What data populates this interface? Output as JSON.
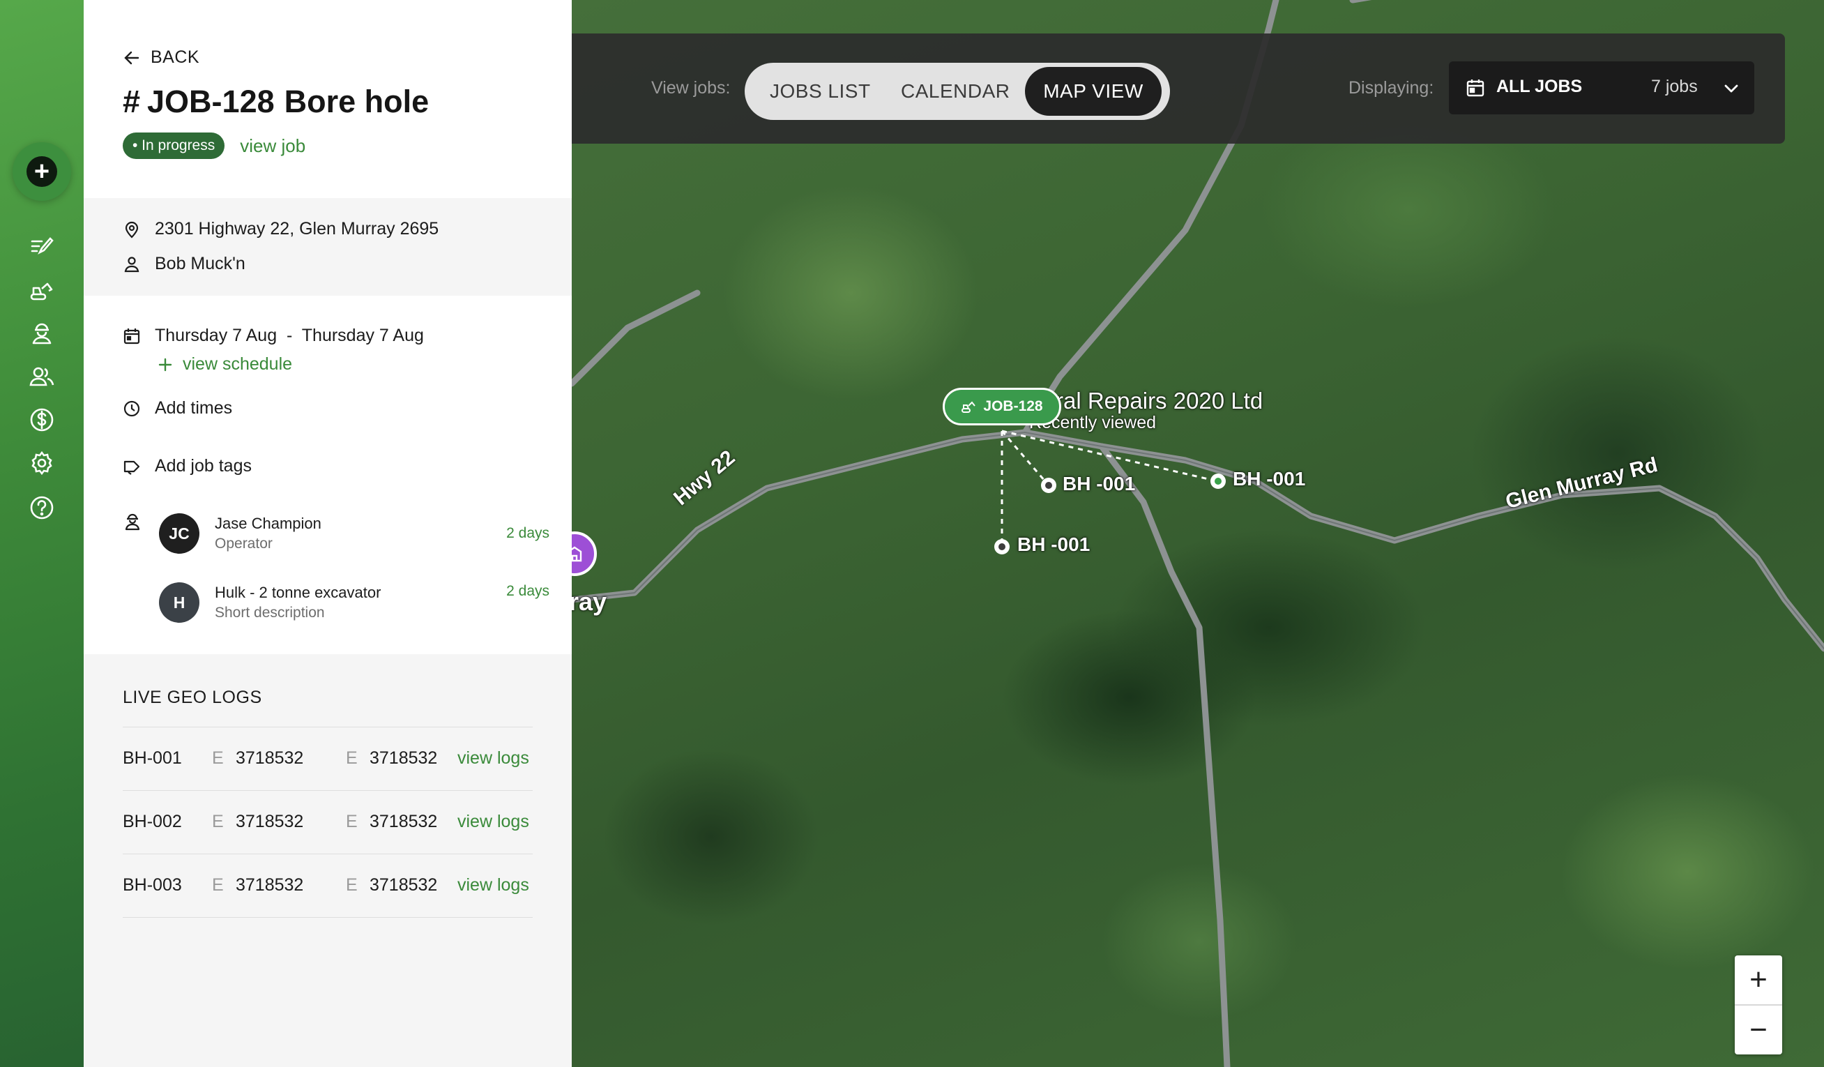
{
  "nav": {
    "add_icon": "plus-circle-icon",
    "items": [
      {
        "icon": "jobs-icon"
      },
      {
        "icon": "machinery-icon"
      },
      {
        "icon": "operator-icon"
      },
      {
        "icon": "users-icon"
      },
      {
        "icon": "dollar-icon"
      },
      {
        "icon": "gear-icon"
      },
      {
        "icon": "help-icon"
      }
    ]
  },
  "panel": {
    "back_label": "BACK",
    "job_hash": "#",
    "job_code": "JOB-128",
    "job_name": "Bore hole",
    "status": "• In progress",
    "view_job": "view job",
    "address": "2301 Highway 22, Glen Murray 2695",
    "customer": "Bob Muck'n",
    "date_range": "Thursday 7 Aug  -  Thursday 7 Aug",
    "view_schedule": "view schedule",
    "add_times": "Add times",
    "add_job_tags": "Add job tags",
    "resources": [
      {
        "initials": "JC",
        "name": "Jase Champion",
        "sub": "Operator",
        "days": "2 days",
        "color": "#1f1f1f"
      },
      {
        "initials": "H",
        "name": "Hulk - 2 tonne excavator",
        "sub": "Short description",
        "days": "2 days",
        "color": "#3b4147"
      }
    ],
    "geo_title": "LIVE GEO LOGS",
    "geo_logs": [
      {
        "id": "BH-001",
        "e1_label": "E",
        "e1": "3718532",
        "e2_label": "E",
        "e2": "3718532",
        "link": "view logs"
      },
      {
        "id": "BH-002",
        "e1_label": "E",
        "e1": "3718532",
        "e2_label": "E",
        "e2": "3718532",
        "link": "view logs"
      },
      {
        "id": "BH-003",
        "e1_label": "E",
        "e1": "3718532",
        "e2_label": "E",
        "e2": "3718532",
        "link": "view logs"
      }
    ]
  },
  "toolbar": {
    "view_label": "View jobs:",
    "tabs": [
      "JOBS LIST",
      "CALENDAR",
      "MAP VIEW"
    ],
    "active_tab": "MAP VIEW",
    "display_label": "Displaying:",
    "filter_value": "ALL JOBS",
    "job_count": "7 jobs"
  },
  "map": {
    "job_marker": "JOB-128",
    "business_name": "ral Repairs 2020 Ltd",
    "recently_viewed": "Recently viewed",
    "bore_labels": [
      "BH -001",
      "BH -001",
      "BH -001"
    ],
    "road_hwy": "Hwy 22",
    "road_glen": "Glen Murray Rd",
    "town_fragment": "ray",
    "zoom_in": "+",
    "zoom_out": "−"
  },
  "colors": {
    "brand_green": "#3a8a3a",
    "status_badge": "#2e6b36",
    "marker_green": "#3a9a4c",
    "pin_purple": "#9d4fd6"
  }
}
